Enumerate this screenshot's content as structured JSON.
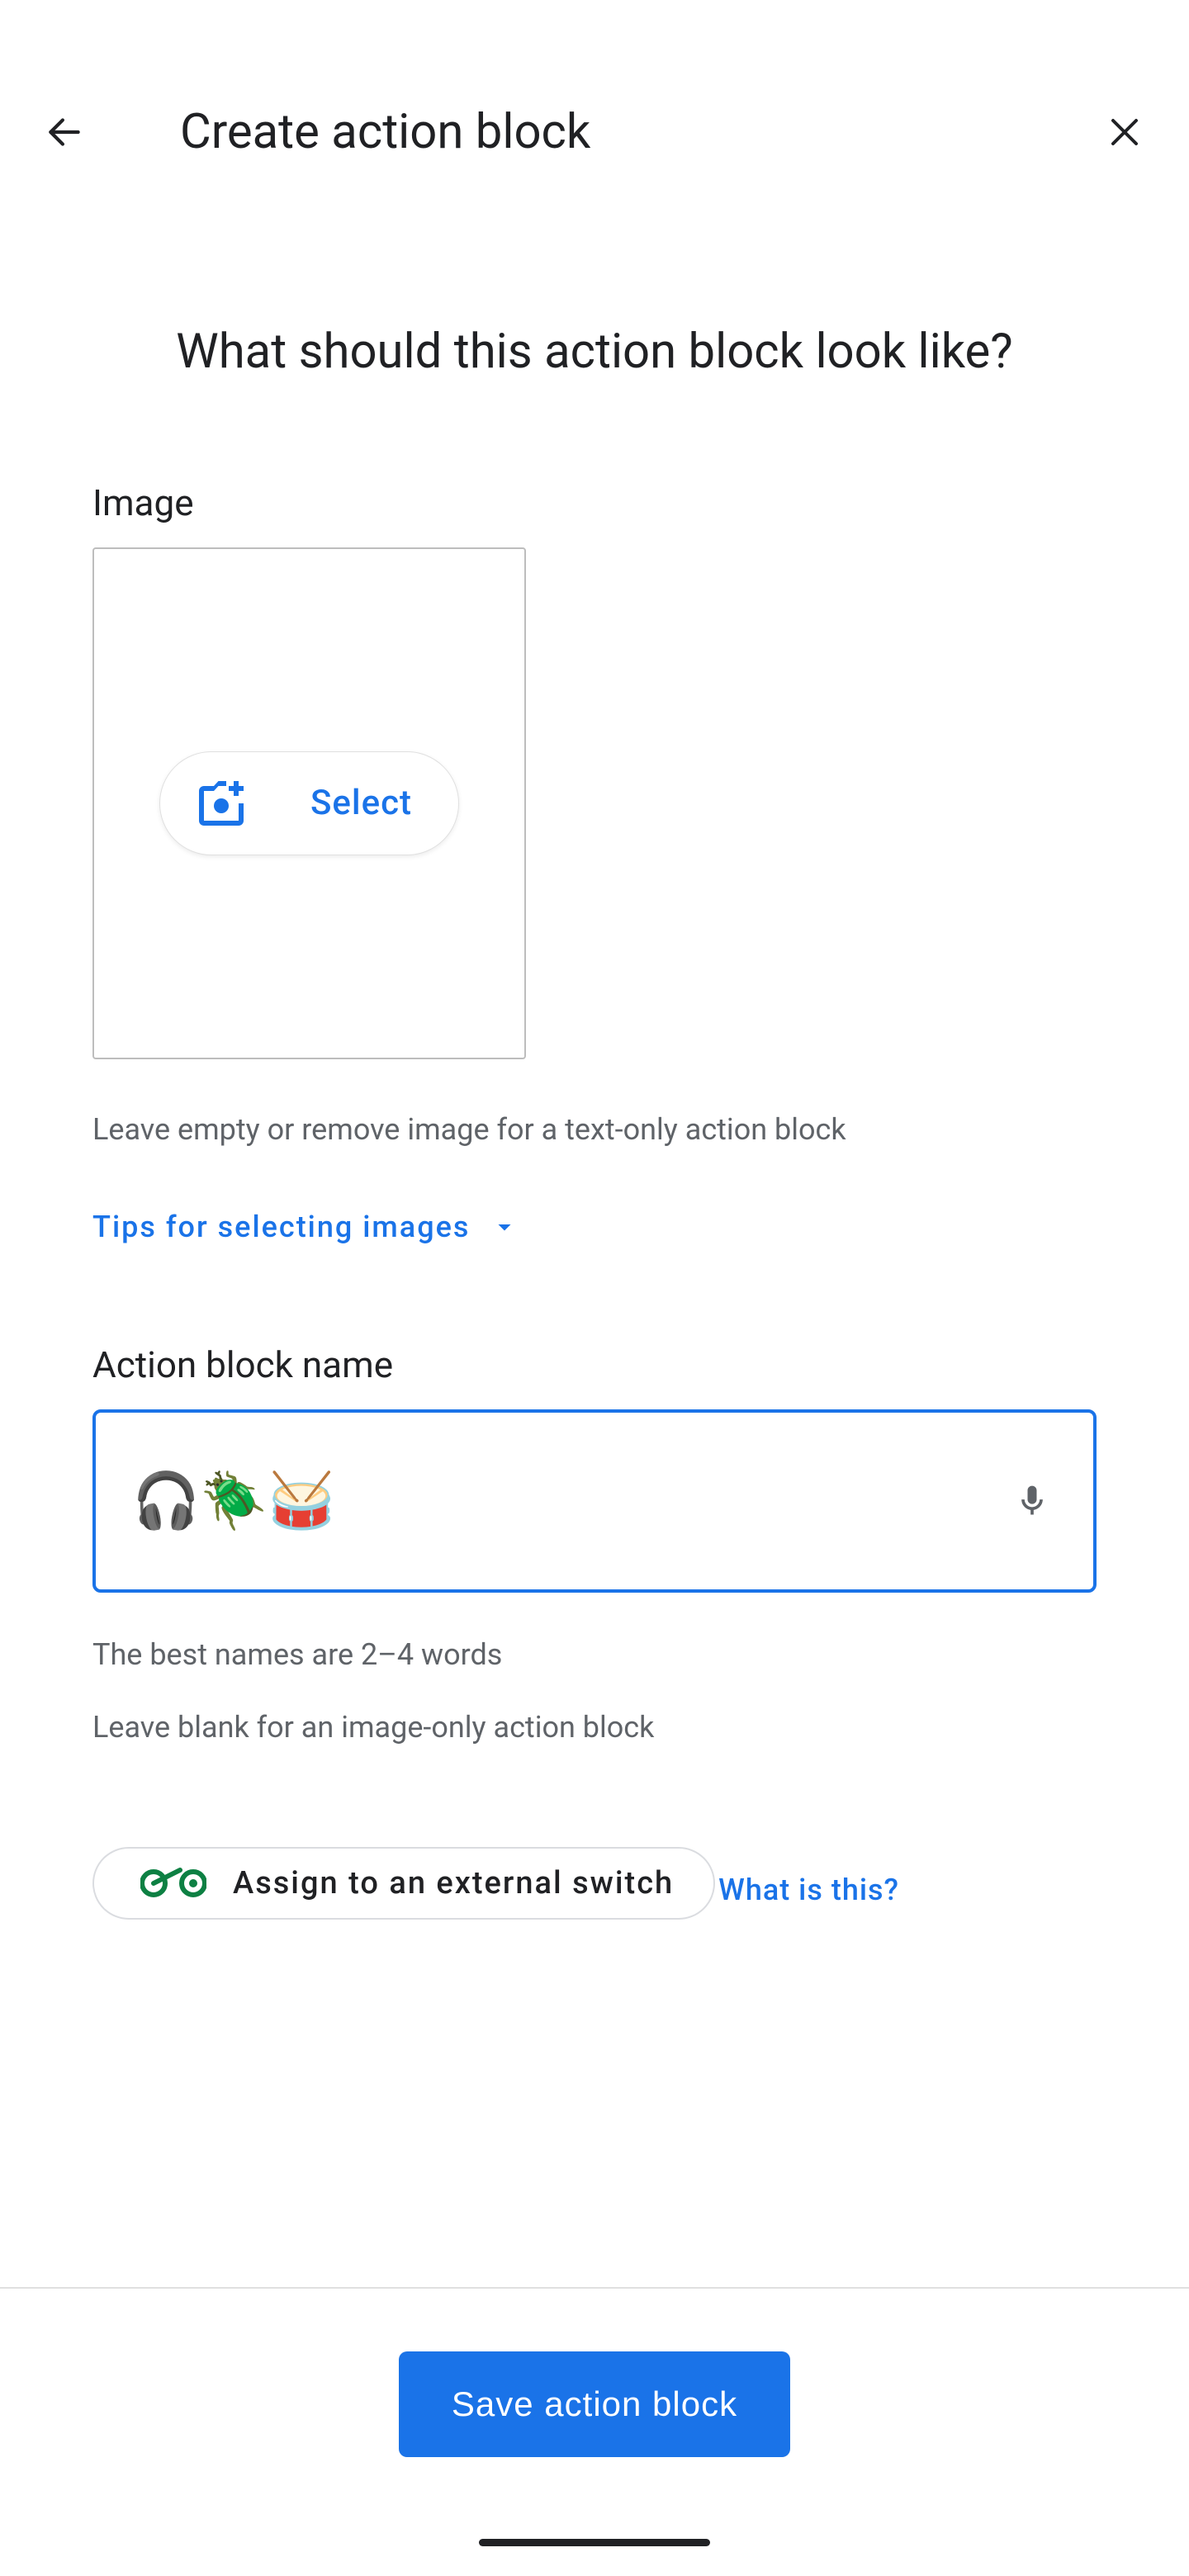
{
  "header": {
    "title": "Create action block"
  },
  "headline": "What should this action block look like?",
  "image_section": {
    "label": "Image",
    "select_button": "Select",
    "helper": "Leave empty or remove image for a text-only action block",
    "tips_link": "Tips for selecting images"
  },
  "name_section": {
    "label": "Action block name",
    "value": "🎧🪲🥁",
    "helper1": "The best names are 2–4 words",
    "helper2": "Leave blank for an image-only action block"
  },
  "assign_switch": {
    "label": "Assign to an external switch",
    "what_is_this": "What is this?"
  },
  "footer": {
    "save_button": "Save action block"
  }
}
